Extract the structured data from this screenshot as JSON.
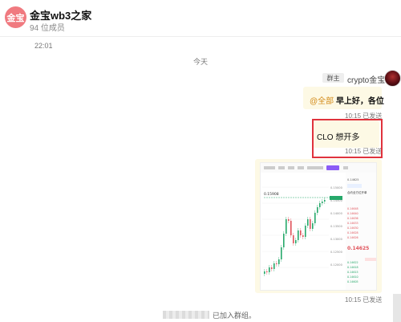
{
  "header": {
    "avatar_text": "金宝",
    "title": "金宝wb3之家",
    "members": "94 位成员"
  },
  "timeline": {
    "first_time": "22:01",
    "today": "今天"
  },
  "sender": {
    "role": "群主",
    "name": "crypto金宝"
  },
  "messages": [
    {
      "mention": "@全部",
      "text": "早上好，各位",
      "time": "10:15",
      "status": "已发送"
    },
    {
      "text": "CLO 想开多",
      "time": "10:15",
      "status": "已发送"
    },
    {
      "time": "10:15",
      "status": "已发送"
    }
  ],
  "chart_image": {
    "price_marker": "0.15908",
    "current_price": "0.14625",
    "axis_ticks": [
      "0.15000",
      "0.14500",
      "0.14000",
      "0.13500",
      "0.13000",
      "0.12500",
      "0.12000"
    ],
    "side_labels": [
      "合约全方位开单",
      "0.14625"
    ]
  },
  "system": {
    "joined_text": "已加入群组。"
  },
  "colors": {
    "highlight_border": "#e0333d",
    "bubble_bg": "#fdf9e5",
    "mention": "#d38b1a",
    "group_avatar": "#f07a80",
    "chart_up": "#26a86a",
    "chart_down": "#e0535b"
  }
}
